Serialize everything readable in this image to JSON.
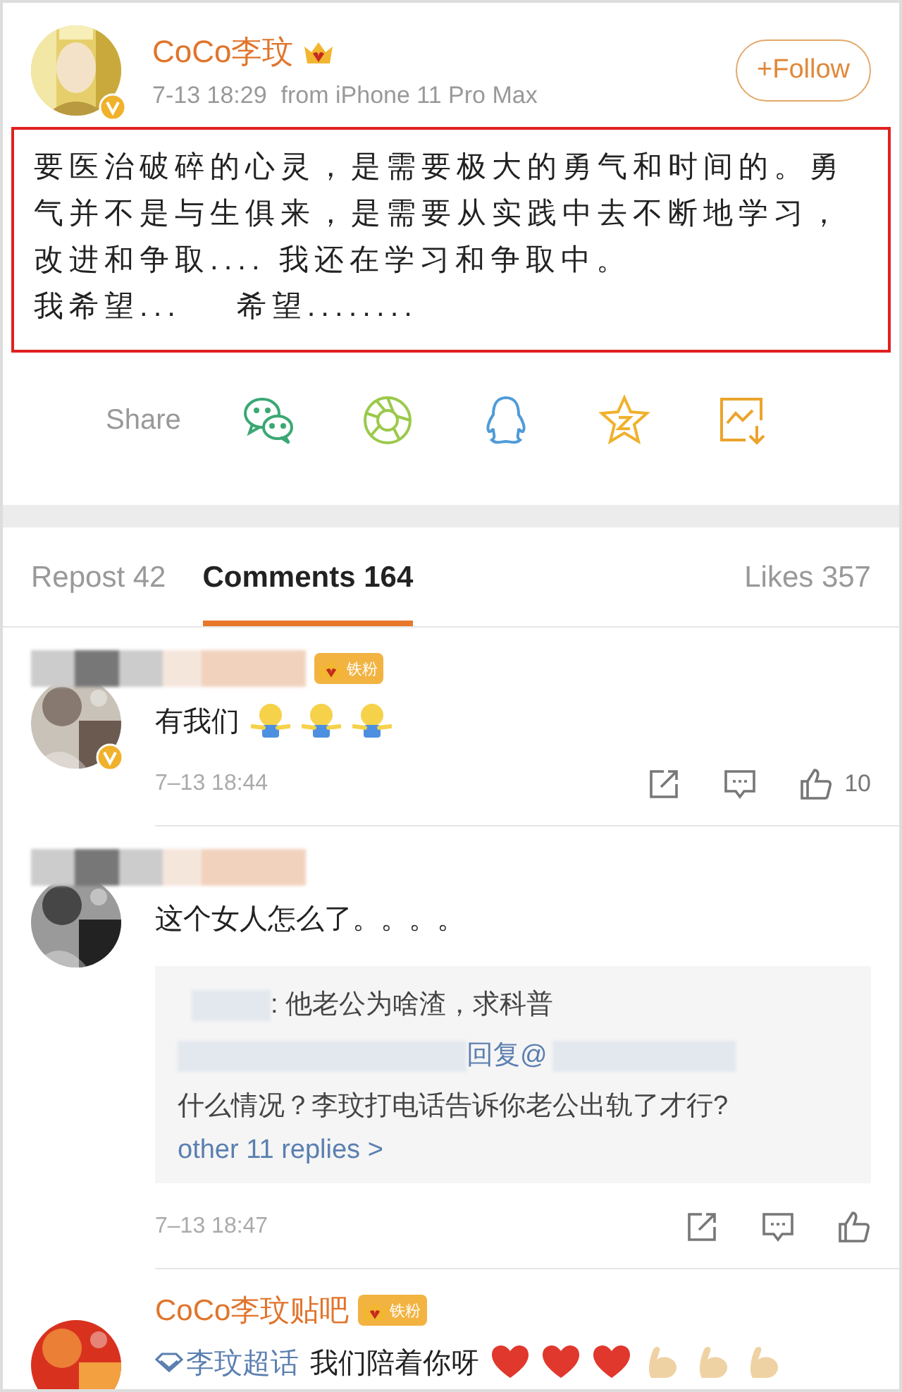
{
  "post": {
    "author": "CoCo李玟",
    "crowned": true,
    "verified": true,
    "time": "7-13 18:29",
    "source": "from iPhone 11 Pro Max",
    "follow_button": "+Follow",
    "paragraphs": [
      "要医治破碎的心灵，是需要极大的勇气和时间的。勇气并不是与生俱来，是需要从实践中去不断地学习，改进和争取.... 我还在学习和争取中。",
      "我希望...    希望........"
    ]
  },
  "share": {
    "label": "Share",
    "targets": [
      {
        "kind": "chat"
      },
      {
        "kind": "shutter"
      },
      {
        "kind": "penguin"
      },
      {
        "kind": "star"
      },
      {
        "kind": "save-image"
      }
    ]
  },
  "tabs": [
    {
      "label": "Repost 42",
      "selected": false
    },
    {
      "label": "Comments 164",
      "selected": true
    },
    {
      "label": "Likes 357",
      "selected": false
    }
  ],
  "comments": [
    {
      "badge": "铁粉",
      "verified": true,
      "text": "有我们",
      "emojis": [
        {
          "kind": "hug"
        },
        {
          "kind": "hug"
        },
        {
          "kind": "hug"
        }
      ],
      "time": "7–13 18:44",
      "likes": "10"
    },
    {
      "verified": false,
      "text": "这个女人怎么了。。。。",
      "replies": [
        {
          "kind": "plain",
          "text": ": 他老公为啥渣，求科普"
        },
        {
          "kind": "reply",
          "link": "回复@",
          "text": "什么情况？李玟打电话告诉你老公出轨了才行?"
        }
      ],
      "more": "other 11 replies >",
      "time": "7–13 18:47"
    },
    {
      "name": "CoCo李玟贴吧",
      "badge": "铁粉",
      "verified": false,
      "topic": "李玟超话",
      "text": "我们陪着你呀",
      "emojis": [
        {
          "kind": "heart"
        },
        {
          "kind": "heart"
        },
        {
          "kind": "heart"
        },
        {
          "kind": "muscle"
        },
        {
          "kind": "muscle"
        },
        {
          "kind": "muscle"
        }
      ]
    }
  ]
}
